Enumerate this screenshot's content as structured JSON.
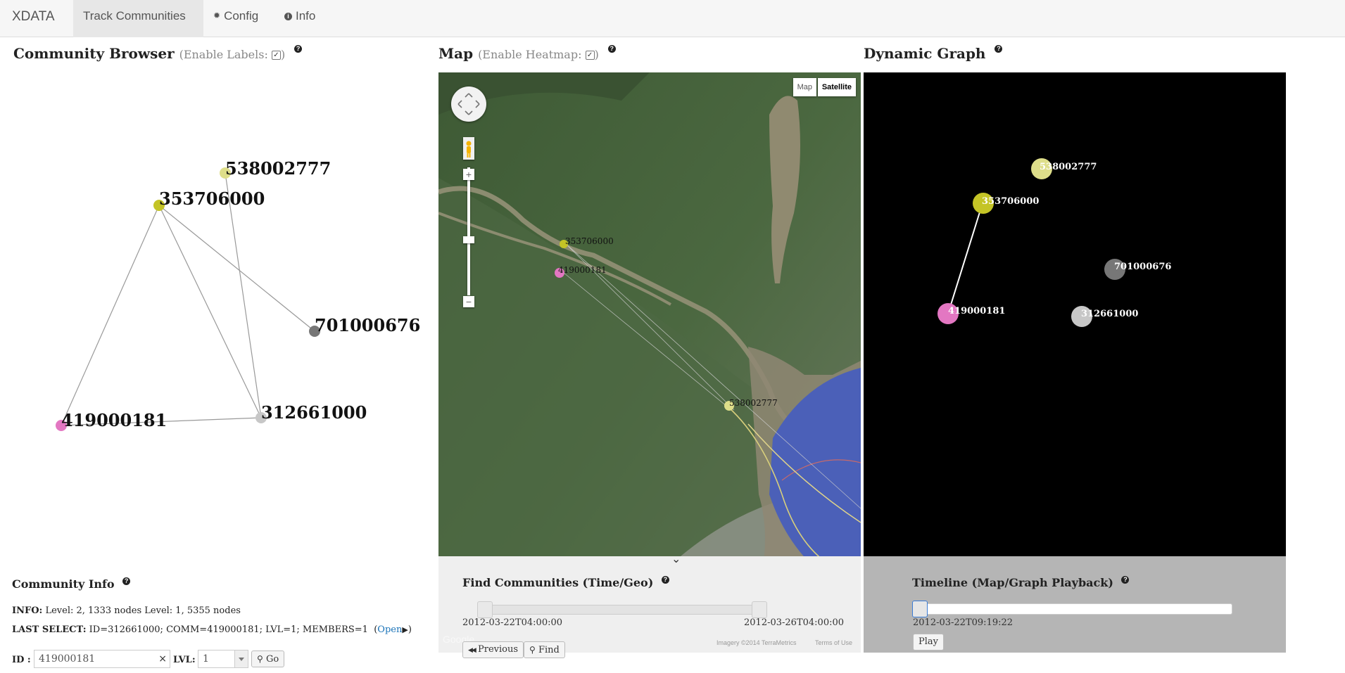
{
  "nav": {
    "brand": "XDATA",
    "items": [
      {
        "label": "Track Communities",
        "icon": "",
        "active": true
      },
      {
        "label": "Config",
        "icon": "✹",
        "active": false
      },
      {
        "label": "Info",
        "icon": "i",
        "active": false
      }
    ]
  },
  "community_browser": {
    "title": "Community Browser",
    "option_open": "(Enable Labels:",
    "option_close": ")",
    "checked_mark": "✓",
    "help": "?",
    "nodes": [
      {
        "id": "538002777",
        "color": "#dede8a"
      },
      {
        "id": "353706000",
        "color": "#c4c426"
      },
      {
        "id": "701000676",
        "color": "#777777"
      },
      {
        "id": "419000181",
        "color": "#e377c2"
      },
      {
        "id": "312661000",
        "color": "#c7c7c7"
      }
    ]
  },
  "map": {
    "title": "Map",
    "option_open": "(Enable Heatmap:",
    "option_close": ")",
    "checked_mark": "✓",
    "help": "?",
    "type_map": "Map",
    "type_satellite": "Satellite",
    "zoom_in": "+",
    "zoom_out": "−",
    "collapse": "⌄",
    "google": "Google",
    "imagery": "Imagery ©2014 TerraMetrics",
    "terms": "Terms of Use",
    "markers": [
      {
        "id": "353706000",
        "color": "#c4c426"
      },
      {
        "id": "419000181",
        "color": "#e377c2"
      },
      {
        "id": "538002777",
        "color": "#dede8a"
      }
    ]
  },
  "dynamic_graph": {
    "title": "Dynamic Graph",
    "help": "?",
    "nodes": [
      {
        "id": "538002777",
        "color": "#dede8a"
      },
      {
        "id": "353706000",
        "color": "#c4c426"
      },
      {
        "id": "701000676",
        "color": "#777777"
      },
      {
        "id": "419000181",
        "color": "#e377c2"
      },
      {
        "id": "312661000",
        "color": "#c7c7c7"
      }
    ]
  },
  "find": {
    "title": "Find Communities (Time/Geo)",
    "help": "?",
    "start": "2012-03-22T04:00:00",
    "end": "2012-03-26T04:00:00",
    "previous_icon": "◀◀",
    "previous_label": "Previous",
    "find_icon": "⚲",
    "find_label": "Find"
  },
  "timeline": {
    "title": "Timeline (Map/Graph Playback)",
    "help": "?",
    "time": "2012-03-22T09:19:22",
    "play_label": "Play"
  },
  "community_info": {
    "title": "Community Info",
    "help": "?",
    "info_label": "INFO:",
    "info_text": "Level: 2, 1333 nodes Level: 1, 5355 nodes",
    "last_label": "LAST SELECT:",
    "last_text": "ID=312661000; COMM=419000181; LVL=1; MEMBERS=1",
    "open_paren": "(",
    "open_link": "Open",
    "open_arrow": "▶",
    "close_paren": ")",
    "id_label": "ID :",
    "id_value": "419000181",
    "clear": "×",
    "lvl_label": "LVL:",
    "lvl_value": "1",
    "go_icon": "⚲",
    "go_label": "Go"
  }
}
